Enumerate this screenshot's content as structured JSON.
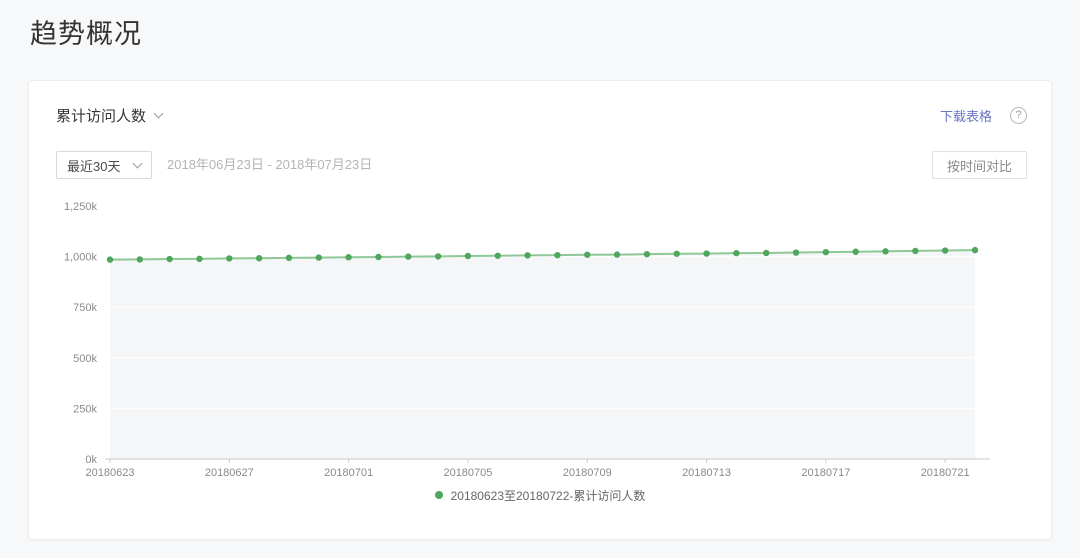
{
  "page": {
    "title": "趋势概况",
    "background": "#f7f8fa"
  },
  "card": {
    "header": {
      "metric_selector_label": "累计访问人数",
      "download_link_label": "下载表格",
      "help_glyph": "?"
    },
    "controls": {
      "range_dropdown_value": "最近30天",
      "date_range_text": "2018年06月23日 - 2018年07月23日",
      "compare_button_label": "按时间对比"
    }
  },
  "icons": {
    "chevron_down": "v",
    "help": "?"
  },
  "chart_data": {
    "type": "line",
    "title": "累计访问人数",
    "series": [
      {
        "name": "20180623至20180722-累计访问人数",
        "x": [
          "20180623",
          "20180624",
          "20180625",
          "20180626",
          "20180627",
          "20180628",
          "20180629",
          "20180630",
          "20180701",
          "20180702",
          "20180703",
          "20180704",
          "20180705",
          "20180706",
          "20180707",
          "20180708",
          "20180709",
          "20180710",
          "20180711",
          "20180712",
          "20180713",
          "20180714",
          "20180715",
          "20180716",
          "20180717",
          "20180718",
          "20180719",
          "20180720",
          "20180721",
          "20180722"
        ],
        "values_k": [
          985,
          986,
          988,
          989,
          991,
          992,
          994,
          995,
          997,
          998,
          1000,
          1001,
          1003,
          1004,
          1006,
          1007,
          1009,
          1010,
          1012,
          1014,
          1015,
          1017,
          1018,
          1020,
          1022,
          1024,
          1026,
          1028,
          1030,
          1032
        ]
      }
    ],
    "y_ticks": [
      "0k",
      "250k",
      "500k",
      "750k",
      "1,000k",
      "1,250k"
    ],
    "ylim": [
      0,
      1250
    ],
    "x_tick_labels": [
      "20180623",
      "20180627",
      "20180701",
      "20180705",
      "20180709",
      "20180713",
      "20180717",
      "20180721"
    ],
    "grid": true,
    "legend_position": "bottom",
    "colors": {
      "line": "#8fc897",
      "point": "#4fa65c",
      "area_fill": "#f5f6f8",
      "axis": "#c9c9c9",
      "tick_text": "#8a8a8a",
      "grid_line": "#ffffff"
    }
  }
}
